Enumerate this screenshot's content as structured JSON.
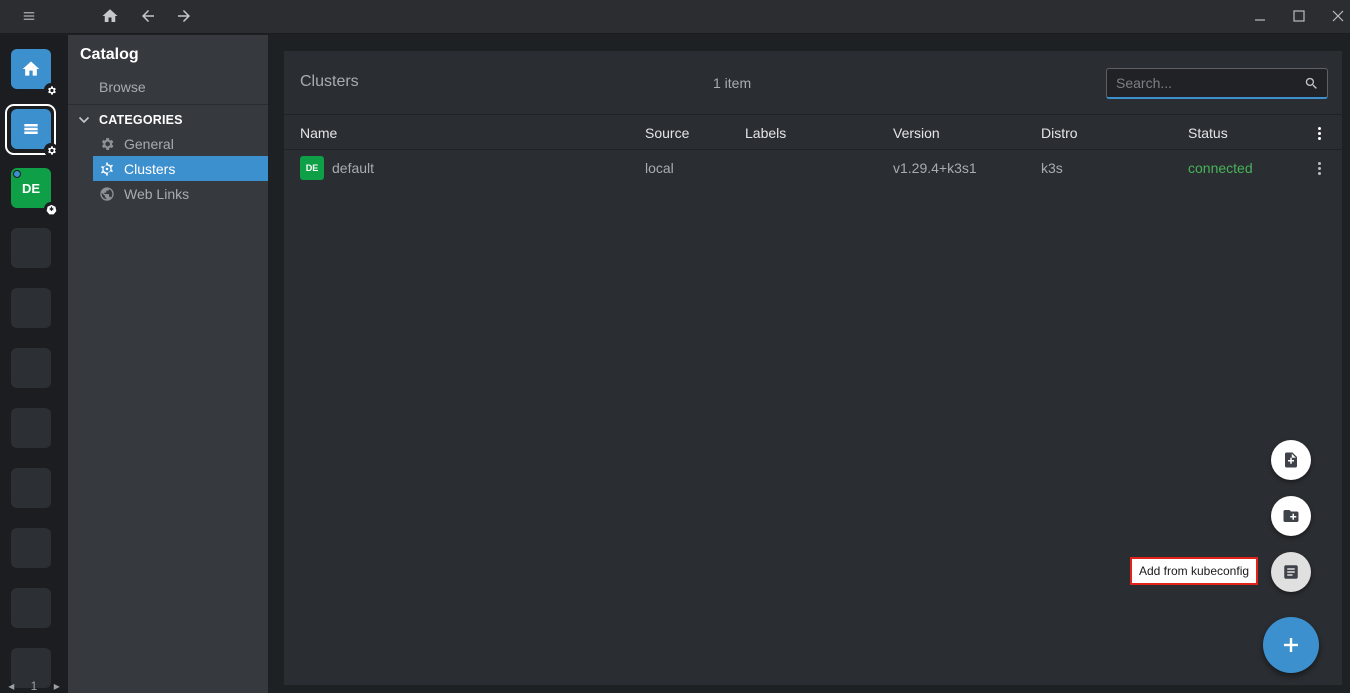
{
  "titlebar": {
    "home_icon": "home-icon",
    "back_icon": "arrow-left-icon",
    "forward_icon": "arrow-right-icon",
    "menu_icon": "hamburger-icon"
  },
  "hotbar": {
    "items": [
      {
        "name": "home",
        "icon": "home-icon",
        "color": "#3d90ce"
      },
      {
        "name": "catalog",
        "icon": "catalog-icon",
        "color": "#3d90ce"
      },
      {
        "name": "cluster-default",
        "initials": "DE",
        "color": "#0fa047"
      }
    ],
    "page_number": "1"
  },
  "sidebar": {
    "title": "Catalog",
    "browse": "Browse",
    "categories_label": "CATEGORIES",
    "items": [
      {
        "label": "General",
        "icon": "gear-icon"
      },
      {
        "label": "Clusters",
        "icon": "kubernetes-icon"
      },
      {
        "label": "Web Links",
        "icon": "globe-icon"
      }
    ]
  },
  "main": {
    "title": "Clusters",
    "count": "1 item",
    "search_placeholder": "Search...",
    "columns": [
      "Name",
      "Source",
      "Labels",
      "Version",
      "Distro",
      "Status"
    ],
    "rows": [
      {
        "badge": "DE",
        "name": "default",
        "source": "local",
        "labels": "",
        "version": "v1.29.4+k3s1",
        "distro": "k3s",
        "status": "connected"
      }
    ]
  },
  "fab": {
    "tooltip": "Add from kubeconfig",
    "accent": "#3d90ce",
    "status_color": "#48b35a"
  }
}
